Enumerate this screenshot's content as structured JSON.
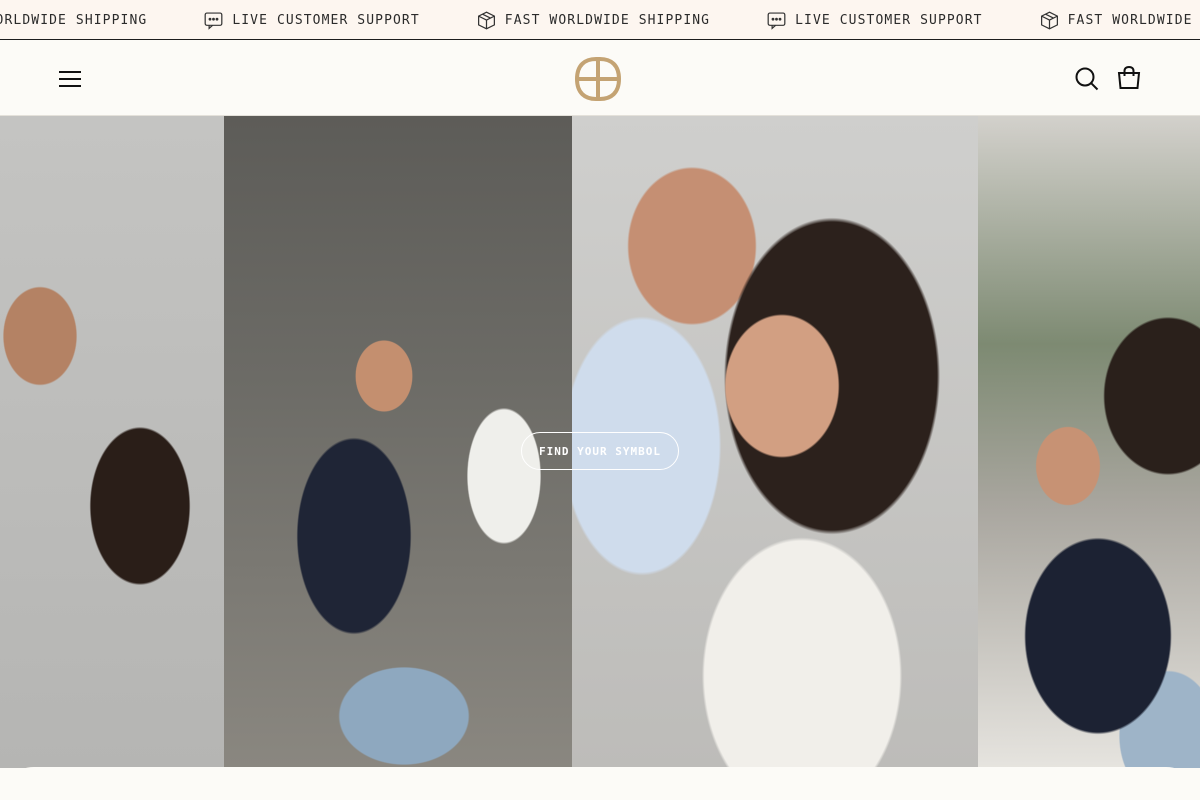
{
  "announcement": {
    "items": [
      {
        "text": "FAST WORLDWIDE SHIPPING",
        "icon": "box-icon"
      },
      {
        "text": "LIVE CUSTOMER SUPPORT",
        "icon": "chat-icon"
      },
      {
        "text": "FAST WORLDWIDE SHIPPING",
        "icon": "box-icon"
      },
      {
        "text": "LIVE CUSTOMER SUPPORT",
        "icon": "chat-icon"
      },
      {
        "text": "FAST WORLDWIDE SHIPPING",
        "icon": "box-icon"
      }
    ]
  },
  "header": {
    "menu_icon": "hamburger-menu-icon",
    "logo_icon": "brand-monogram-logo",
    "search_icon": "search-icon",
    "cart_icon": "shopping-bag-icon",
    "logo_color": "#c4a373"
  },
  "hero": {
    "cta_label": "FIND YOUR SYMBOL"
  },
  "colors": {
    "announcement_bg": "#fdf6f0",
    "page_bg": "#fcfbf7",
    "text": "#1d1d1d"
  }
}
